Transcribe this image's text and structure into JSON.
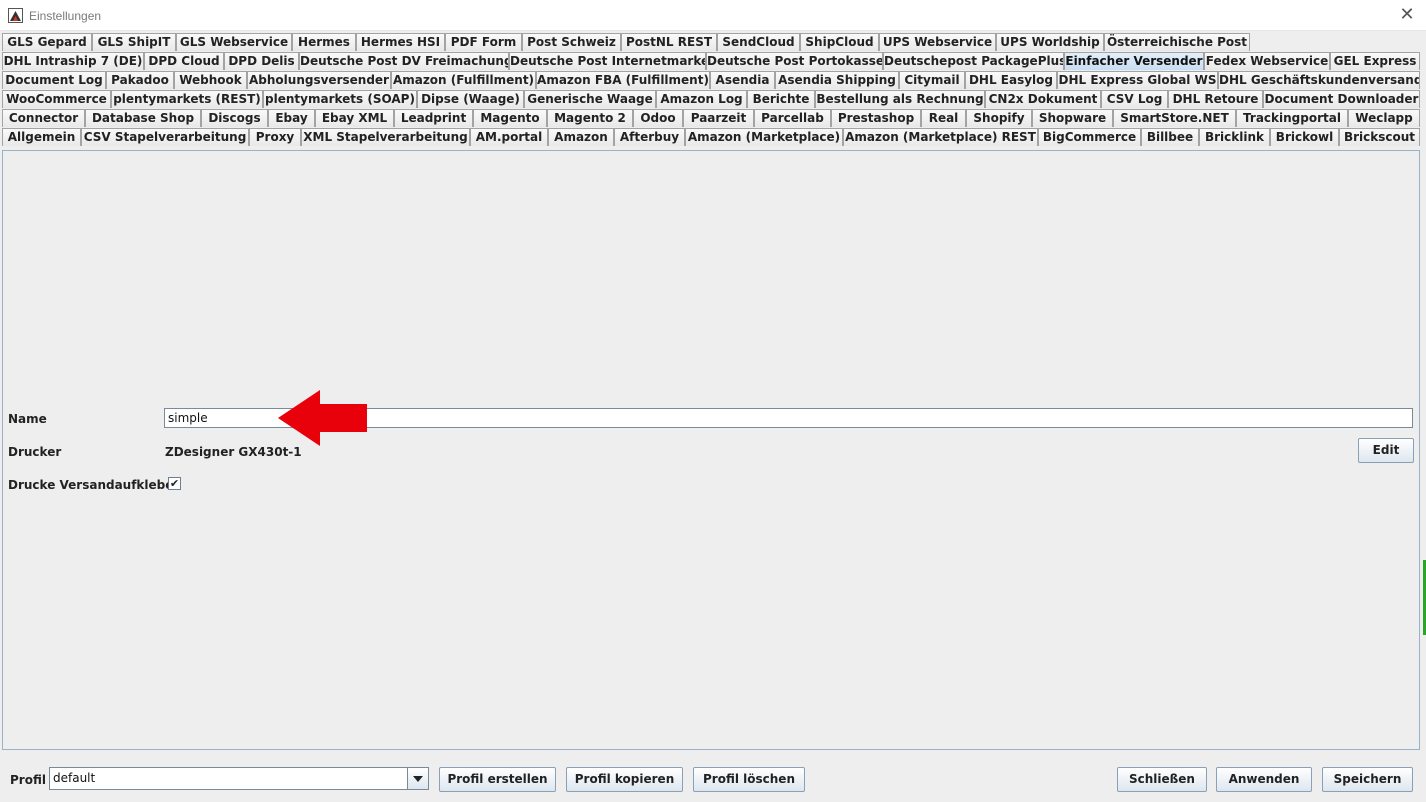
{
  "window": {
    "title": "Einstellungen",
    "close_glyph": "✕"
  },
  "tab_rows": [
    {
      "tabs": [
        {
          "label": "GLS Gepard"
        },
        {
          "label": "GLS ShipIT"
        },
        {
          "label": "GLS Webservice"
        },
        {
          "label": "Hermes"
        },
        {
          "label": "Hermes HSI"
        },
        {
          "label": "PDF Form"
        },
        {
          "label": "Post Schweiz"
        },
        {
          "label": "PostNL REST"
        },
        {
          "label": "SendCloud"
        },
        {
          "label": "ShipCloud"
        },
        {
          "label": "UPS Webservice"
        },
        {
          "label": "UPS Worldship"
        },
        {
          "label": "Österreichische Post"
        }
      ]
    },
    {
      "tabs": [
        {
          "label": "DHL Intraship 7 (DE)"
        },
        {
          "label": "DPD Cloud"
        },
        {
          "label": "DPD Delis"
        },
        {
          "label": "Deutsche Post DV Freimachung"
        },
        {
          "label": "Deutsche Post Internetmarke"
        },
        {
          "label": "Deutsche Post Portokasse"
        },
        {
          "label": "Deutschepost PackagePlus"
        },
        {
          "label": "Einfacher Versender",
          "selected": true
        },
        {
          "label": "Fedex Webservice"
        },
        {
          "label": "GEL Express"
        }
      ]
    },
    {
      "tabs": [
        {
          "label": "Document Log"
        },
        {
          "label": "Pakadoo"
        },
        {
          "label": "Webhook"
        },
        {
          "label": "Abholungsversender"
        },
        {
          "label": "Amazon (Fulfillment)"
        },
        {
          "label": "Amazon FBA (Fulfillment)"
        },
        {
          "label": "Asendia"
        },
        {
          "label": "Asendia Shipping"
        },
        {
          "label": "Citymail"
        },
        {
          "label": "DHL Easylog"
        },
        {
          "label": "DHL Express Global WS"
        },
        {
          "label": "DHL Geschäftskundenversand"
        }
      ]
    },
    {
      "tabs": [
        {
          "label": "WooCommerce"
        },
        {
          "label": "plentymarkets (REST)"
        },
        {
          "label": "plentymarkets (SOAP)"
        },
        {
          "label": "Dipse (Waage)"
        },
        {
          "label": "Generische Waage"
        },
        {
          "label": "Amazon Log"
        },
        {
          "label": "Berichte"
        },
        {
          "label": "Bestellung als Rechnung"
        },
        {
          "label": "CN2x Dokument"
        },
        {
          "label": "CSV Log"
        },
        {
          "label": "DHL Retoure"
        },
        {
          "label": "Document Downloader"
        }
      ]
    },
    {
      "tabs": [
        {
          "label": "Connector"
        },
        {
          "label": "Database Shop"
        },
        {
          "label": "Discogs"
        },
        {
          "label": "Ebay"
        },
        {
          "label": "Ebay XML"
        },
        {
          "label": "Leadprint"
        },
        {
          "label": "Magento"
        },
        {
          "label": "Magento 2"
        },
        {
          "label": "Odoo"
        },
        {
          "label": "Paarzeit"
        },
        {
          "label": "Parcellab"
        },
        {
          "label": "Prestashop"
        },
        {
          "label": "Real"
        },
        {
          "label": "Shopify"
        },
        {
          "label": "Shopware"
        },
        {
          "label": "SmartStore.NET"
        },
        {
          "label": "Trackingportal"
        },
        {
          "label": "Weclapp"
        }
      ]
    },
    {
      "tabs": [
        {
          "label": "Allgemein"
        },
        {
          "label": "CSV Stapelverarbeitung"
        },
        {
          "label": "Proxy"
        },
        {
          "label": "XML Stapelverarbeitung"
        },
        {
          "label": "AM.portal"
        },
        {
          "label": "Amazon"
        },
        {
          "label": "Afterbuy"
        },
        {
          "label": "Amazon (Marketplace)"
        },
        {
          "label": "Amazon (Marketplace) REST"
        },
        {
          "label": "BigCommerce"
        },
        {
          "label": "Billbee"
        },
        {
          "label": "Bricklink"
        },
        {
          "label": "Brickowl"
        },
        {
          "label": "Brickscout"
        }
      ]
    }
  ],
  "form": {
    "name_label": "Name",
    "name_value": "simple",
    "printer_label": "Drucker",
    "printer_value": "ZDesigner GX430t-1",
    "edit_button": "Edit",
    "print_label_label": "Drucke Versandaufkleber",
    "print_label_checked": true,
    "check_glyph": "✔"
  },
  "footer": {
    "profile_label": "Profil",
    "profile_value": "default",
    "create_profile": "Profil erstellen",
    "copy_profile": "Profil kopieren",
    "delete_profile": "Profil löschen",
    "close": "Schließen",
    "apply": "Anwenden",
    "save": "Speichern"
  },
  "colors": {
    "arrow": "#e8000b",
    "selected_tab": "#c8ddf2",
    "panel_border": "#9ab2c9",
    "edge_accent": "#2aa52a"
  },
  "icons": {
    "app": "app-logo-icon",
    "close": "close-icon",
    "dropdown": "triangle-down-icon",
    "arrow": "red-arrow-left-icon"
  }
}
